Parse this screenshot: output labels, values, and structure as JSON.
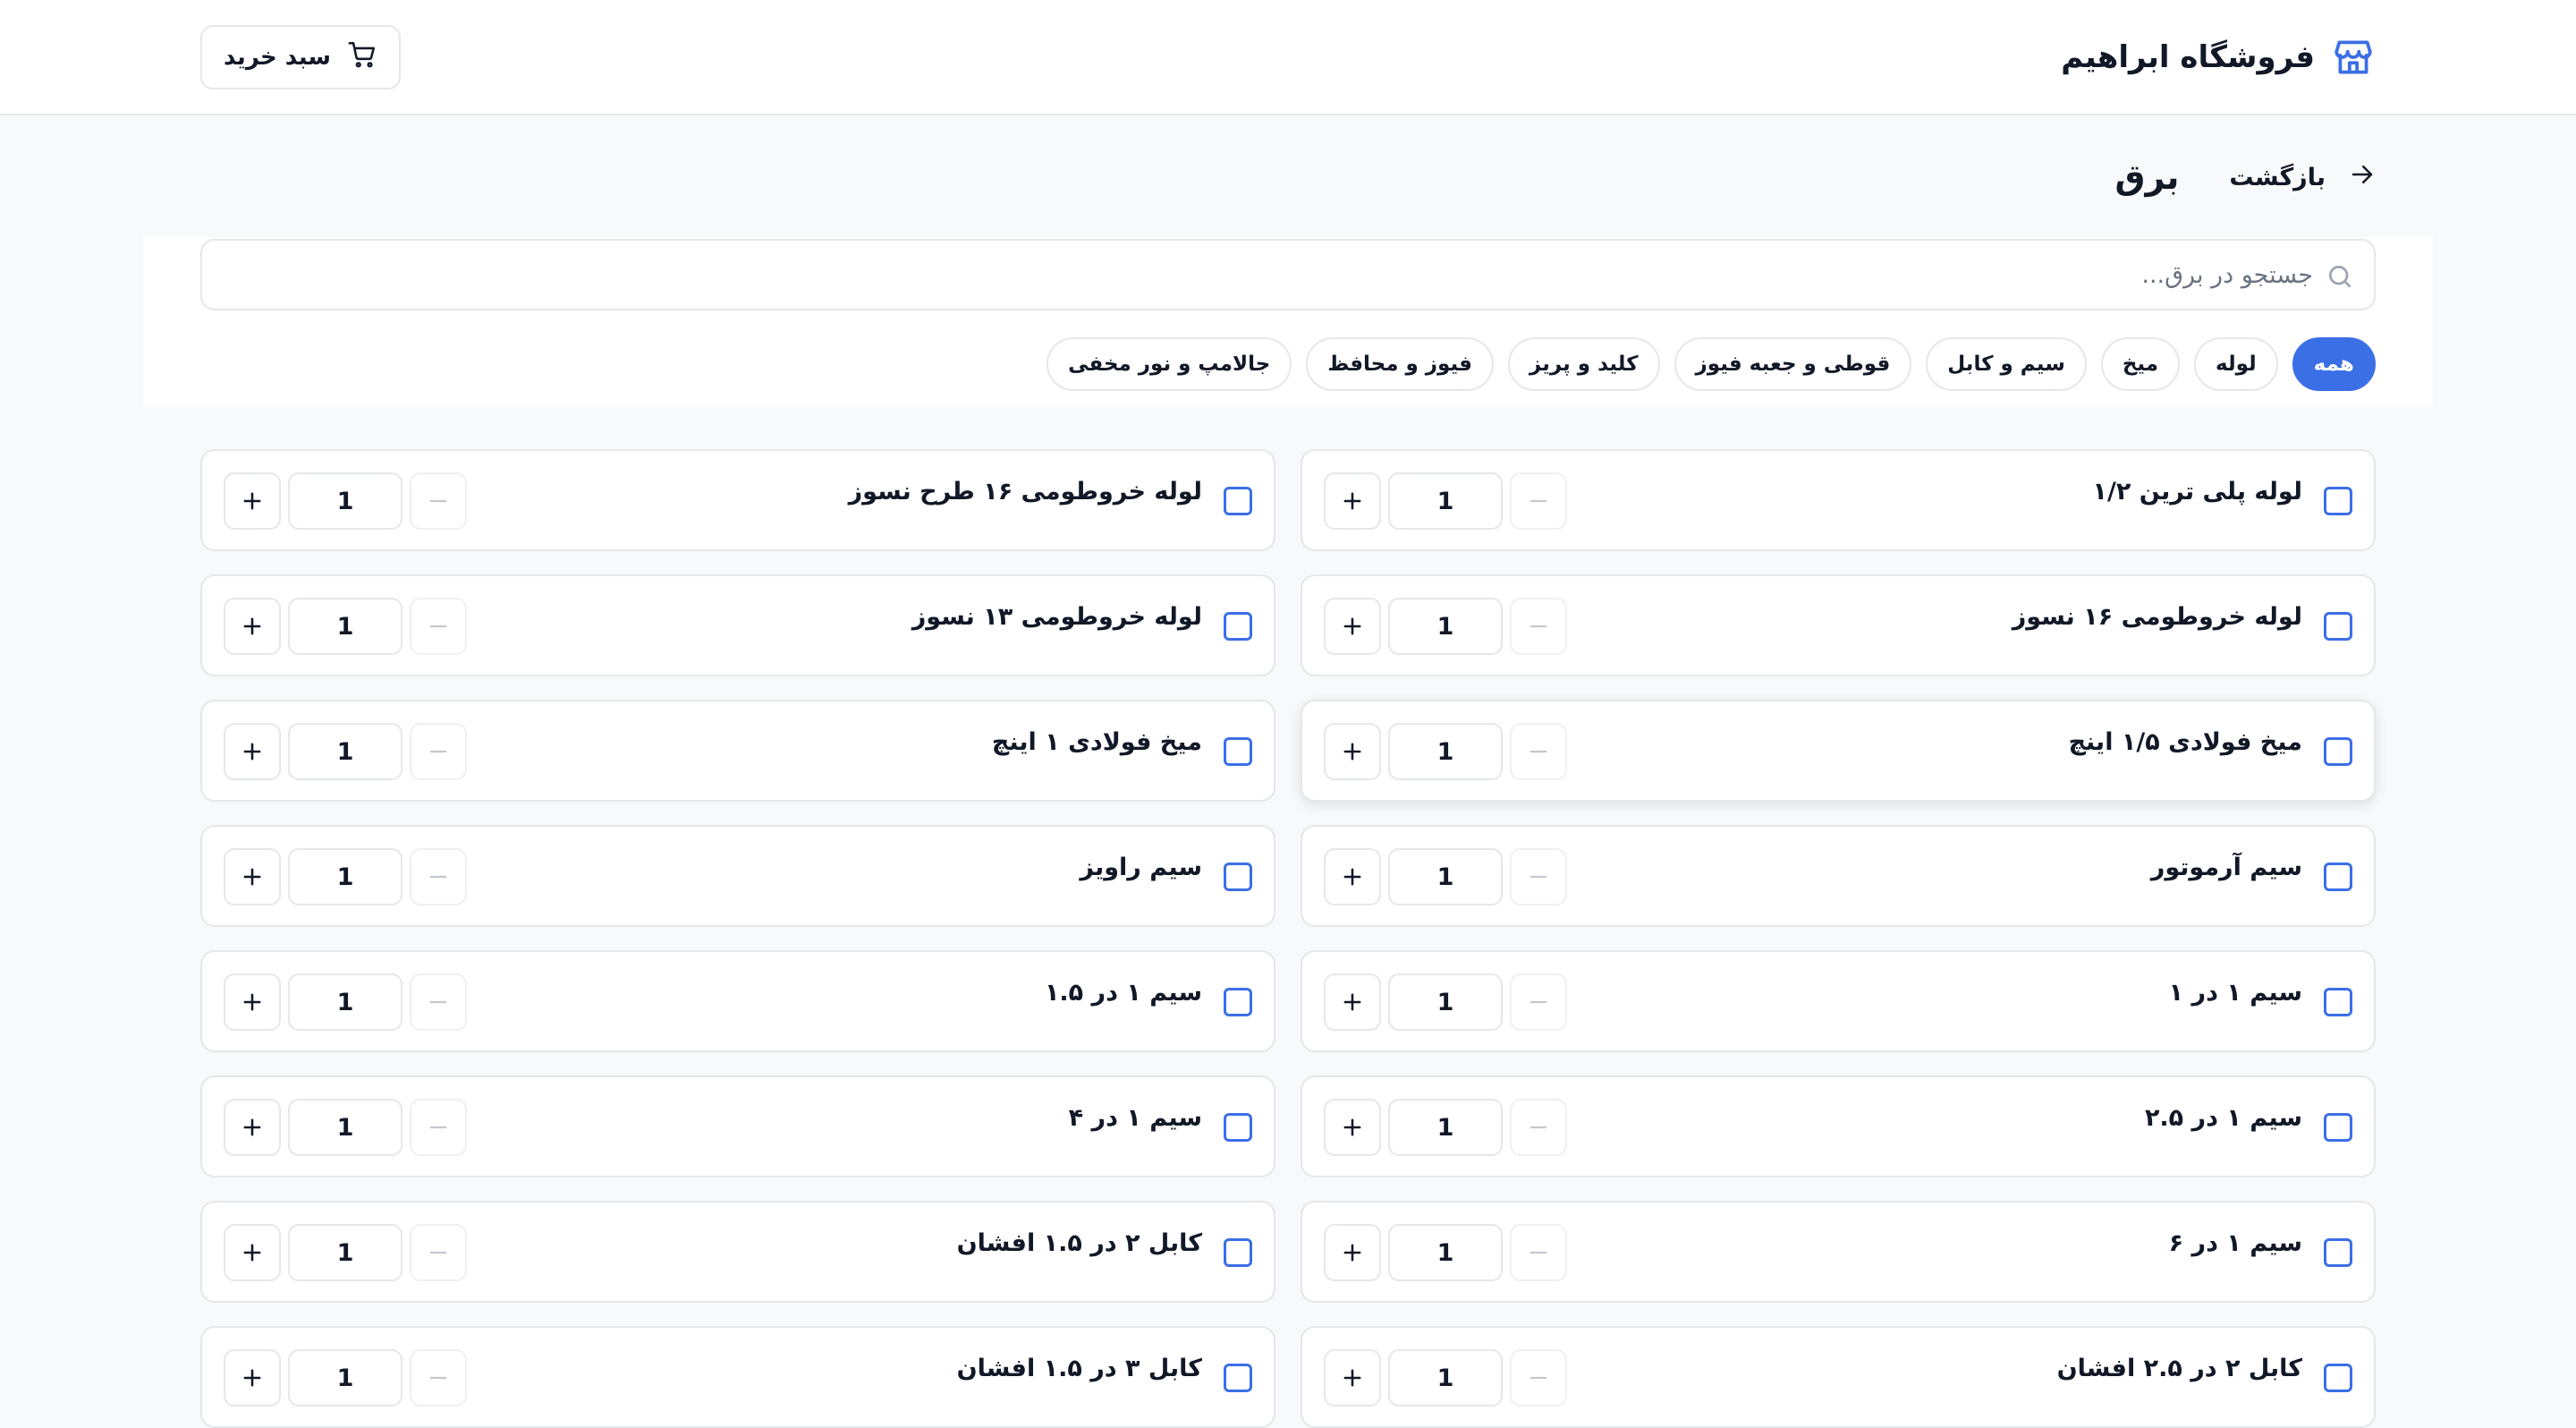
{
  "header": {
    "store_name": "فروشگاه ابراهیم",
    "cart_label": "سبد خرید"
  },
  "page": {
    "back_label": "بازگشت",
    "title": "برق"
  },
  "search": {
    "placeholder": "جستجو در برق...",
    "value": ""
  },
  "categories": [
    {
      "label": "همه",
      "active": true
    },
    {
      "label": "لوله",
      "active": false
    },
    {
      "label": "میخ",
      "active": false
    },
    {
      "label": "سیم و کابل",
      "active": false
    },
    {
      "label": "قوطی و جعبه فیوز",
      "active": false
    },
    {
      "label": "کلید و پریز",
      "active": false
    },
    {
      "label": "فیوز و محافظ",
      "active": false
    },
    {
      "label": "جالامپ و نور مخفی",
      "active": false
    }
  ],
  "products": [
    {
      "name": "لوله پلی ترین ۱/۲",
      "qty": "1"
    },
    {
      "name": "لوله خروطومی ۱۶ طرح نسوز",
      "qty": "1"
    },
    {
      "name": "لوله خروطومی ۱۶ نسوز",
      "qty": "1"
    },
    {
      "name": "لوله خروطومی ۱۳ نسوز",
      "qty": "1"
    },
    {
      "name": "میخ فولادی ۱/۵ اینچ",
      "qty": "1"
    },
    {
      "name": "میخ فولادی ۱ اینچ",
      "qty": "1"
    },
    {
      "name": "سیم آرموتور",
      "qty": "1"
    },
    {
      "name": "سیم راویز",
      "qty": "1"
    },
    {
      "name": "سیم ۱ در ۱",
      "qty": "1"
    },
    {
      "name": "سیم ۱ در ۱.۵",
      "qty": "1"
    },
    {
      "name": "سیم ۱ در ۲.۵",
      "qty": "1"
    },
    {
      "name": "سیم ۱ در ۴",
      "qty": "1"
    },
    {
      "name": "سیم ۱ در ۶",
      "qty": "1"
    },
    {
      "name": "کابل ۲ در ۱.۵ افشان",
      "qty": "1"
    },
    {
      "name": "کابل ۲ در ۲.۵ افشان",
      "qty": "1"
    },
    {
      "name": "کابل ۳ در ۱.۵ افشان",
      "qty": "1"
    }
  ],
  "colors": {
    "accent": "#3b6fe6",
    "border": "#e5e7eb",
    "background": "#f8f9fa"
  },
  "icons": {
    "brand": "store-icon",
    "cart": "shopping-cart-icon",
    "back": "arrow-right-icon",
    "search": "search-icon",
    "minus": "minus-icon",
    "plus": "plus-icon"
  }
}
